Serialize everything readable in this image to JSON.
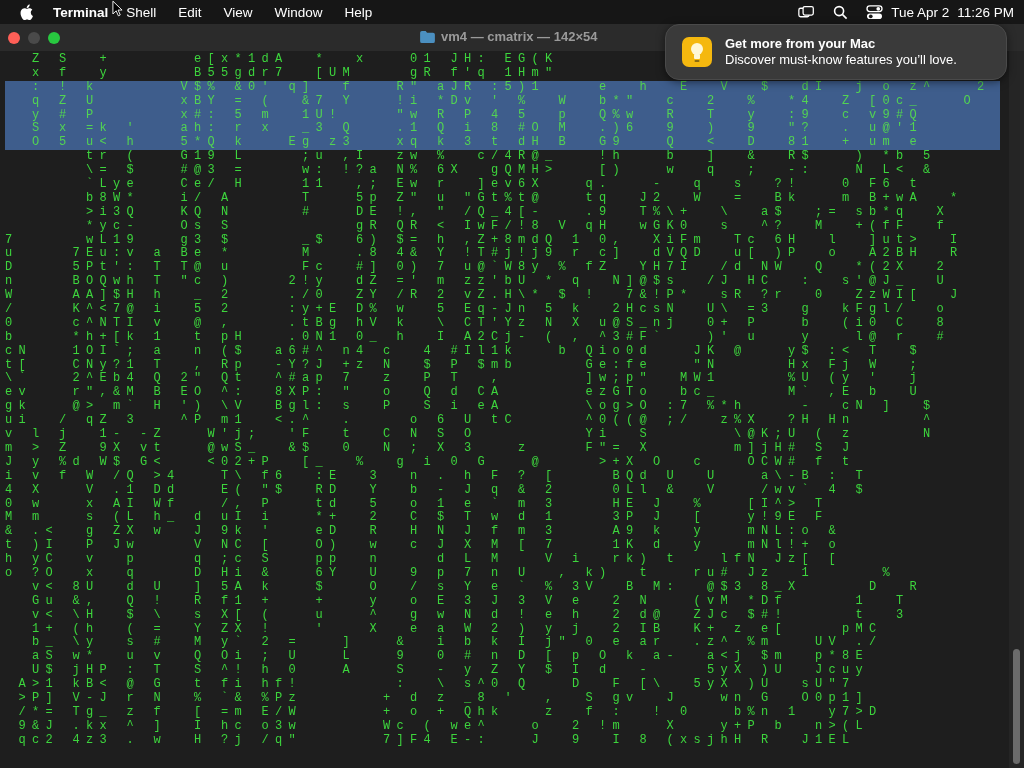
{
  "menu_bar": {
    "app_name": "Terminal",
    "menus": [
      "Shell",
      "Edit",
      "View",
      "Window",
      "Help"
    ],
    "date": "Tue Apr 2",
    "time": "11:26 PM"
  },
  "window": {
    "title": "vm4 — cmatrix — 142×54"
  },
  "notification": {
    "title": "Get more from your Mac",
    "body": "Discover must-know features you’ll love."
  },
  "terminal_lines": [
    {
      "text": "  Z S  +      e[x*1dA  *  x   01 JH: EG(K",
      "selected": false
    },
    {
      "text": "  x f  y      B55gdr7  [UM    gR f'q 1Hm\"",
      "selected": false
    },
    {
      "text": "  : ! k      V$% &0' q]  f   R\" aJR :5)1    e  h  E  V  $  dI  j o z^   2",
      "selected": true
    },
    {
      "text": "  q Z U      xBY = (  &7 Y   !i *Dv ' %  W  b*\"  c  2  %  *4  Z [0c_   O",
      "selected": true
    },
    {
      "text": "  y # P      x#: 5 m  1U!    \"w R P 4 5  p  Q%w  R  T  y  :9  c v9#Q",
      "selected": true
    },
    {
      "text": "  S x =k '   ah: r x  _3 Q   .1 Q i 8 #O M  .)6  9  )  9  \"?  . u@'1",
      "selected": true
    },
    {
      "text": "  O 5 u< h   5*Q k   Eg z3   xq k 3 t dH B  G9   Q  <  D  81  + um e",
      "selected": true
    },
    {
      "text": "      tr (   G19 L    ;u ,I  zw %  c/4R@_   !h   b  ]  &  R$   ) *b 5",
      "selected": false
    },
    {
      "text": "      \\= $   #@3 =    w: !?a N% 6X  gQMH>   [)   w  q  ;  -:   N L< &",
      "selected": false
    },
    {
      "text": "      `Lye   Ce/ H    11  ,; Ew r  ]ev6X   q.   -  q  s  ?!   0 F6 t",
      "selected": false
    },
    {
      "text": "      b8W*   i/ A     T   5p Z\" u \"Gt%t@   tq  J2  W  =  Bk   m B+wA  *",
      "selected": false
    },
    {
      "text": "      >i3Q   KQ N     #   DE !, \" /Q_4[-   .9  T%\\+  \\  a$  ;= sb*q  X",
      "selected": false
    },
    {
      "text": "      *yc-   Os S         gR QR < IwF/!8 V qH  wGK0  s  ^?  M  +(fF  f",
      "selected": false
    },
    {
      "text": "7     wL19   g3 $     _$  6) $= h ,Z+8mdQ 1 0,  XiFm  Tc 6H  l  ]ut>  I",
      "selected": false
    },
    {
      "text": "u    7Eu:v a Be *     M   .8 4& Y !T#j!j9 r c]  dVQD  u[ )P  o  A2BH  R",
      "selected": false
    },
    {
      "text": "D    5Pt': T T@ u     Fc  #] 0) 7 u@`W8y % fZ  YH7I  /d NW  Q  *(2X  2",
      "selected": false
    },
    {
      "text": "n    BOQwh T \"c )    2!y  dZ =' m zz'bU * q  N]@$s  /J HC  :  s'@J_  U",
      "selected": false
    },
    {
      "text": "W    AA]$H h  _ 2    ./0  ZY /R 2 vZ.H\\* $ !  7&!P*  sR ?r  0  ZzWI[  J",
      "selected": false
    },
    {
      "text": "/    K^<7@ i  5 2    :y+E D% w  5 Eq-Jn 5 k  2HcsN  U\\ =3  g  kFgl/  o",
      "selected": false
    },
    {
      "text": "0    c^NTI v  @ ,    .tBg hV k  \\ CT'Yz N X u@S_nj  0+ P   b  (i0 C  8",
      "selected": false
    },
    {
      "text": "b    *h+[k 1  t pH   .0N1 0_ h  I A2Cj- ( , ^3#F`   )' u   y   l@ r  #",
      "selected": false
    },
    {
      "text": "cN   1OI`; a  n ($  a6#^ n4 c  4 #Il1k   b Qio0d   JK @   y$ :< T  $",
      "selected": false
    },
    {
      "text": "t[   CNy?1 T  , Rp  -Y?J +z N  $ P $mb     Ge:fe   \"N     Hx Fj W  ;",
      "selected": false
    },
    {
      "text": "\\`   2^Eb4 Q 2\" Qt  ^#ap 7  z  P T  ,      ]w;p\"  MW1     %U (y '  j",
      "selected": false
    },
    {
      "text": "ev   r\",&M B EO ^:  8XP: \"  o  Q d CA      ezGTo  bc_     M` ,E b  U",
      "selected": false
    },
    {
      "text": "gk   @> m` H ') \\V  Bgl: s  P  S i eA      \\og>O :7 %*h    -  cN ]  $",
      "selected": false
    },
    {
      "text": "ui  / qZ 3   ^P m1  <.^  .    o 6 U tC     ^0((@ ;/  z%X  ?H Hn     ^",
      "selected": false
    },
    {
      "text": "v l j  1- -Z   W'j;  'F  t  C N S O        Yi  S      \\@K;U ( z     N",
      "selected": false
    },
    {
      "text": "m > Z  9X vt   @wS_  &$  0  N ; X 3   z    F\"= X      m]jH# S J",
      "selected": false
    },
    {
      "text": "J y %d W$ G<   <02+P  [_  %  g i 0 G   @    >+X O  c   OCW# f t",
      "selected": false
    },
    {
      "text": "i v f W /Q >4   T\\ f6  :E  3  n . h F ? [    BQd U  U   a\\-B : T",
      "selected": false
    },
    {
      "text": "4 X   V .1 Dd   E( \"$  RD  Y  b - J q & 2    0Ll &  V   /wv` 4 $",
      "selected": false
    },
    {
      "text": "0 w   x AI Wf   /, P   td  5  o 1 e ` m 3    HE J  %   [I^> T",
      "selected": false
    },
    {
      "text": "M m   s (L h_ d uI i   *+  2  C $ T w d 1    3P J  [   y!9E F",
      "selected": false
    },
    {
      "text": "& .<  g ZX w  J 9k '   eD  R  H N J f m 3    A9 k  y   mNL:o &",
      "selected": false
    },
    {
      "text": "t )I  P Jw    V NC [   O)  w  c J X M [ 7    1K d  y   mNl!+ o",
      "selected": false
    },
    {
      "text": "h yC  v  p    q ;c S   pp  n    d L M   V i  rk) t   lfN Jz[ [",
      "selected": false
    },
    {
      "text": "o ?O  x  q    D Hi &   6Y  U  9 p 7 n U  , k)  t   ru# Jz  1     %",
      "selected": false
    },
    {
      "text": "  v< 8U  d U  ] 5A k   $   O  / s Y e ` % 3V  B M:  @$3 8_X     D  R",
      "selected": false
    },
    {
      "text": "  Gu &,  Q !  R f1 +   +   y  o E 3 J 3 V e  2 N   (vM *Df     1  T",
      "selected": false
    },
    {
      "text": "  v< \\H  $ \\  s X[ (   u   ^  g w N d ! e h  2 d@  ZJc $#!     t  3",
      "selected": false
    },
    {
      "text": "  1+ (h  ( =  Y ZX !   '   X  e a W 2 ) y j  2 IB  K+ z e[    pMC",
      "selected": false
    },
    {
      "text": "  b_ \\y  s #  M y` 2 =   ]   &  i b k I j\" 0 e ar  .z^ %m   UV ./",
      "selected": false
    },
    {
      "text": "  aS w*  u v  Q Oi ; U   L   9  0 # n D [ p O k a-  a<j $m  p*8E",
      "selected": false
    },
    {
      "text": "  U$ jHP : T  S ^! h 0   A   S  - y Z Y $ I d  -    5yX )U  Jcuy",
      "selected": false
    },
    {
      "text": " A>1 kB< @ G  t fi hf!       :  \\ s^0 Q   D  F [\\  5yX )U  sU\"7",
      "selected": false
    },
    {
      "text": " >P] V-J r N  % `& %Pz      + d z _8 '  ,  S gv  J   wn G  O0p1]",
      "selected": false
    },
    {
      "text": " /*= Tg_ z f  [ =m E/W      + o + Qhk   z  f :  ! 0   b%n 1  y7>D",
      "selected": false
    },
    {
      "text": " 9&J .kx ^ ]  I hc o3w      Wc ( we^   o  2 !m   X   y+P b  n>(L",
      "selected": false
    },
    {
      "text": " qc2 4z3 . w  H ?j /q\"      7]F4 E-:   J  9  I 8 (xsjhH R  J1EL",
      "selected": false
    }
  ]
}
